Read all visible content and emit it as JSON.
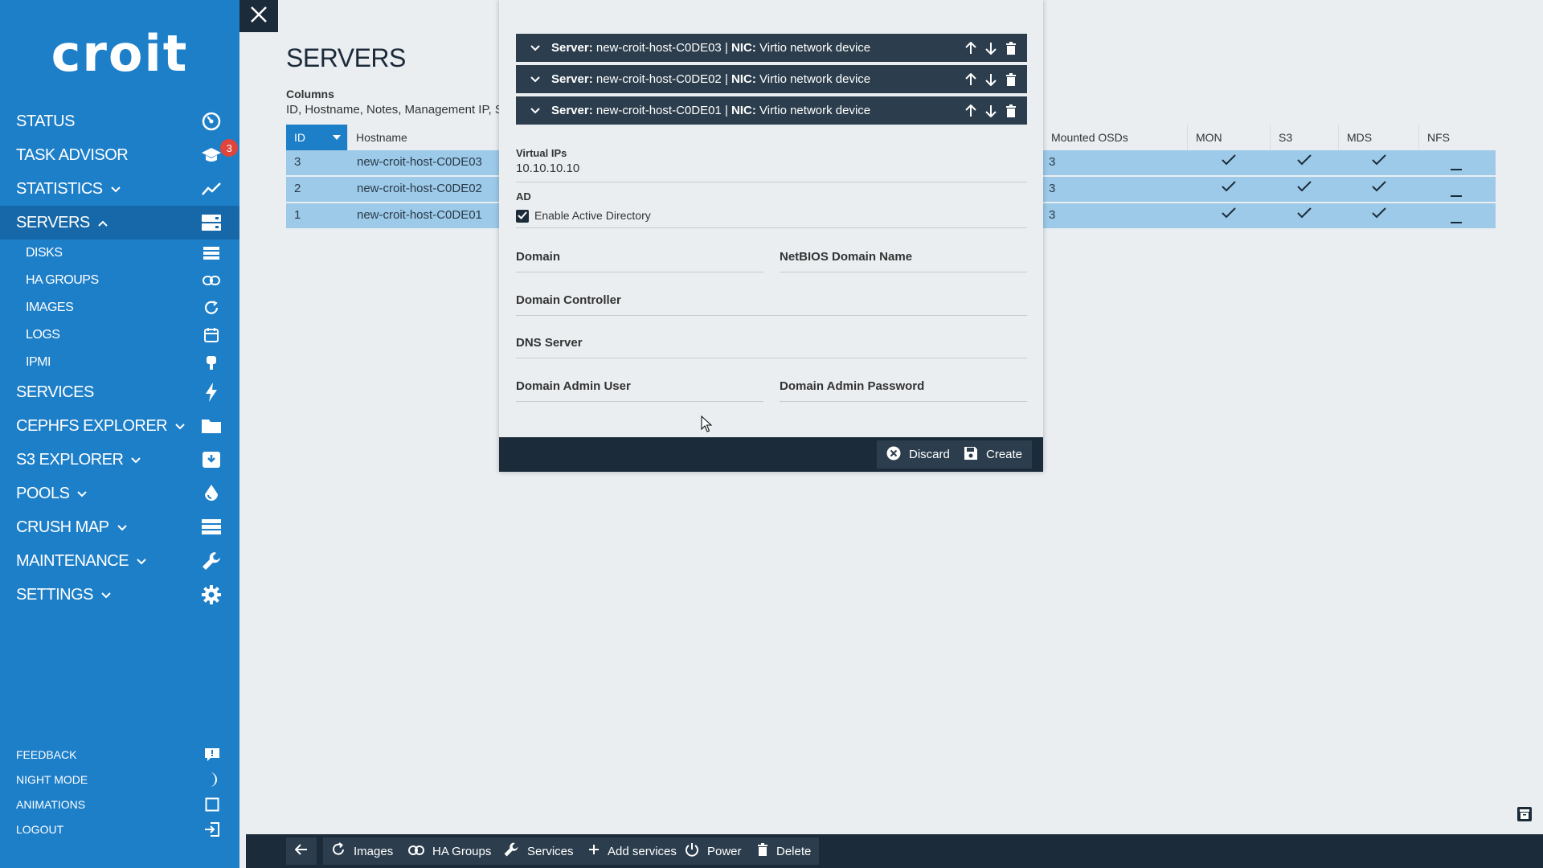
{
  "app": {
    "logo_text": "croit"
  },
  "sidebar": {
    "items": [
      {
        "label": "STATUS",
        "icon": "speedometer-icon"
      },
      {
        "label": "TASK ADVISOR",
        "icon": "graduation-cap-icon",
        "badge": "3"
      },
      {
        "label": "STATISTICS",
        "icon": "chart-line-icon"
      },
      {
        "label": "SERVERS",
        "icon": "server-icon"
      },
      {
        "label": "SERVICES",
        "icon": "lightning-icon"
      },
      {
        "label": "CEPHFS EXPLORER",
        "icon": "folder-icon"
      },
      {
        "label": "S3 EXPLORER",
        "icon": "archive-icon"
      },
      {
        "label": "POOLS",
        "icon": "drop-icon"
      },
      {
        "label": "CRUSH MAP",
        "icon": "list-icon"
      },
      {
        "label": "MAINTENANCE",
        "icon": "wrench-icon"
      },
      {
        "label": "SETTINGS",
        "icon": "gear-icon"
      }
    ],
    "sub_items": [
      {
        "label": "DISKS",
        "icon": "list-icon"
      },
      {
        "label": "HA GROUPS",
        "icon": "link-icon"
      },
      {
        "label": "IMAGES",
        "icon": "refresh-icon"
      },
      {
        "label": "LOGS",
        "icon": "calendar-icon"
      },
      {
        "label": "IPMI",
        "icon": "plug-icon"
      }
    ],
    "footer": [
      {
        "label": "FEEDBACK",
        "icon": "comment-icon"
      },
      {
        "label": "NIGHT MODE",
        "icon": "moon-icon"
      },
      {
        "label": "ANIMATIONS",
        "icon": "square-icon"
      },
      {
        "label": "LOGOUT",
        "icon": "logout-icon"
      }
    ]
  },
  "main": {
    "title": "SERVERS",
    "columns_label": "Columns",
    "columns_value": "ID, Hostname, Notes, Management IP, S",
    "table": {
      "headers": [
        "ID",
        "Hostname",
        "Mounted OSDs",
        "MON",
        "S3",
        "MDS",
        "NFS"
      ],
      "rows": [
        {
          "id": "3",
          "hostname": "new-croit-host-C0DE03",
          "osds": "3"
        },
        {
          "id": "2",
          "hostname": "new-croit-host-C0DE02",
          "osds": "3"
        },
        {
          "id": "1",
          "hostname": "new-croit-host-C0DE01",
          "osds": "3"
        }
      ]
    }
  },
  "modal": {
    "nics": [
      {
        "server_label": "Server:",
        "server": "new-croit-host-C0DE03",
        "sep": "|",
        "nic_label": "NIC:",
        "nic": "Virtio network device"
      },
      {
        "server_label": "Server:",
        "server": "new-croit-host-C0DE02",
        "sep": "|",
        "nic_label": "NIC:",
        "nic": "Virtio network device"
      },
      {
        "server_label": "Server:",
        "server": "new-croit-host-C0DE01",
        "sep": "|",
        "nic_label": "NIC:",
        "nic": "Virtio network device"
      }
    ],
    "virtual_ips_label": "Virtual IPs",
    "virtual_ips_value": "10.10.10.10",
    "ad_label": "AD",
    "enable_ad_label": "Enable Active Directory",
    "enable_ad_checked": true,
    "fields": {
      "domain": "Domain",
      "netbios": "NetBIOS Domain Name",
      "domain_controller": "Domain Controller",
      "dns_server": "DNS Server",
      "admin_user": "Domain Admin User",
      "admin_password": "Domain Admin Password"
    },
    "discard_label": "Discard",
    "create_label": "Create"
  },
  "toolbar": {
    "images": "Images",
    "ha_groups": "HA Groups",
    "services": "Services",
    "add_services": "Add services",
    "power": "Power",
    "delete": "Delete"
  },
  "colors": {
    "sidebar": "#1e7fc9",
    "dark": "#1c2b3a",
    "row_selected": "#9ccae8",
    "badge": "#e0443a"
  }
}
